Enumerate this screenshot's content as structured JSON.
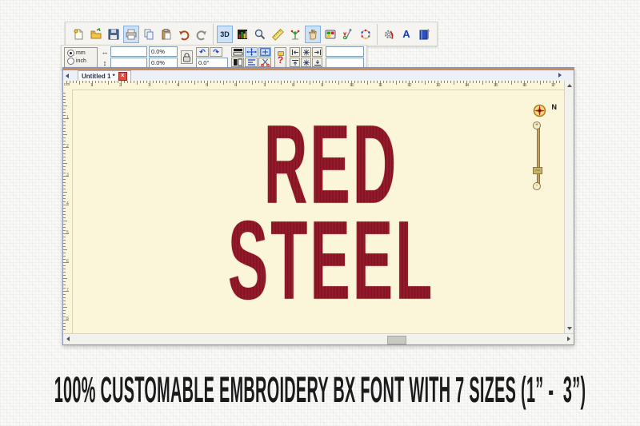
{
  "caption": "100% CUSTOMABLE EMBROIDERY BX FONT WITH 7 SIZES (1” -  3”)",
  "design": {
    "line1": "RED",
    "line2": "STEEL",
    "thread_color": "#9d1c2e",
    "canvas_color": "#fbf6d9"
  },
  "doc": {
    "tab_label": "Untitled 1 *",
    "tab_close": "x",
    "ruler_unit": "cm",
    "compass_label": "N",
    "zoom_plus": "+",
    "zoom_minus": "-"
  },
  "toolbar_main": {
    "buttons": [
      {
        "name": "new"
      },
      {
        "name": "open"
      },
      {
        "name": "save"
      },
      {
        "name": "print",
        "selected": true
      },
      {
        "name": "copy"
      },
      {
        "name": "paste"
      },
      {
        "name": "undo"
      },
      {
        "name": "redo"
      },
      {
        "name": "3d-view",
        "label": "3D",
        "selected": true
      },
      {
        "name": "density-map"
      },
      {
        "name": "zoom"
      },
      {
        "name": "measure"
      },
      {
        "name": "stitch-points"
      },
      {
        "name": "pan-hand",
        "selected": true
      },
      {
        "name": "color-palette"
      },
      {
        "name": "thread"
      },
      {
        "name": "stitch-pattern"
      },
      {
        "name": "properties"
      },
      {
        "name": "lettering",
        "label": "A"
      },
      {
        "name": "library"
      }
    ]
  },
  "transform_bar": {
    "unit_mm": "mm",
    "unit_inch": "inch",
    "selected_unit": "mm",
    "width_value": "",
    "width_percent": "0.0%",
    "height_value": "",
    "height_percent": "0.0%",
    "rotation_value": "0.0°",
    "help_label": "?",
    "pos_x_value": "",
    "pos_y_value": ""
  },
  "rulers": {
    "h_numbers": [
      "1",
      "2",
      "3",
      "4",
      "5",
      "6",
      "7",
      "8",
      "9",
      "10",
      "11",
      "12",
      "13",
      "14",
      "15",
      "16",
      "17"
    ],
    "v_numbers": [
      "1",
      "2",
      "3",
      "4",
      "5",
      "6",
      "7",
      "8"
    ]
  },
  "colors": {
    "selection_blue": "#cde2f6",
    "accent_orange": "#cf8a4e",
    "thread_red": "#9d1c2e"
  }
}
